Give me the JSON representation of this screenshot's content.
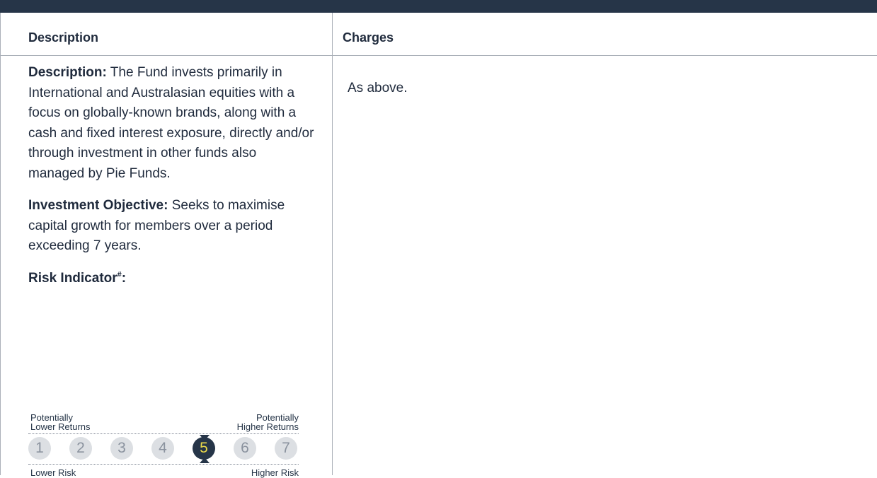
{
  "table": {
    "headers": {
      "description": "Description",
      "charges": "Charges"
    },
    "left": {
      "description_label": "Description:",
      "description_text": " The Fund invests primarily in International and Australasian equities with a focus on globally-known brands, along with a cash and fixed interest exposure, directly and/or through investment in other funds also managed by Pie Funds.",
      "objective_label": "Investment Objective:",
      "objective_text": " Seeks to maximise capital growth for members over a period exceeding 7 years.",
      "risk_label": "Risk Indicator",
      "risk_sup": "#",
      "risk_colon": ":"
    },
    "right": {
      "charges_text": "As above."
    }
  },
  "risk_indicator": {
    "top_left": "Potentially\nLower Returns",
    "top_right": "Potentially\nHigher Returns",
    "bottom_left": "Lower Risk",
    "bottom_right": "Higher Risk",
    "levels": [
      "1",
      "2",
      "3",
      "4",
      "5",
      "6",
      "7"
    ],
    "selected_level": 5,
    "selected_color": "#263548",
    "selected_text_color": "#e8d84a"
  },
  "colors": {
    "top_bar": "#263548",
    "border": "#aab0b8",
    "text": "#1f2a3c"
  }
}
